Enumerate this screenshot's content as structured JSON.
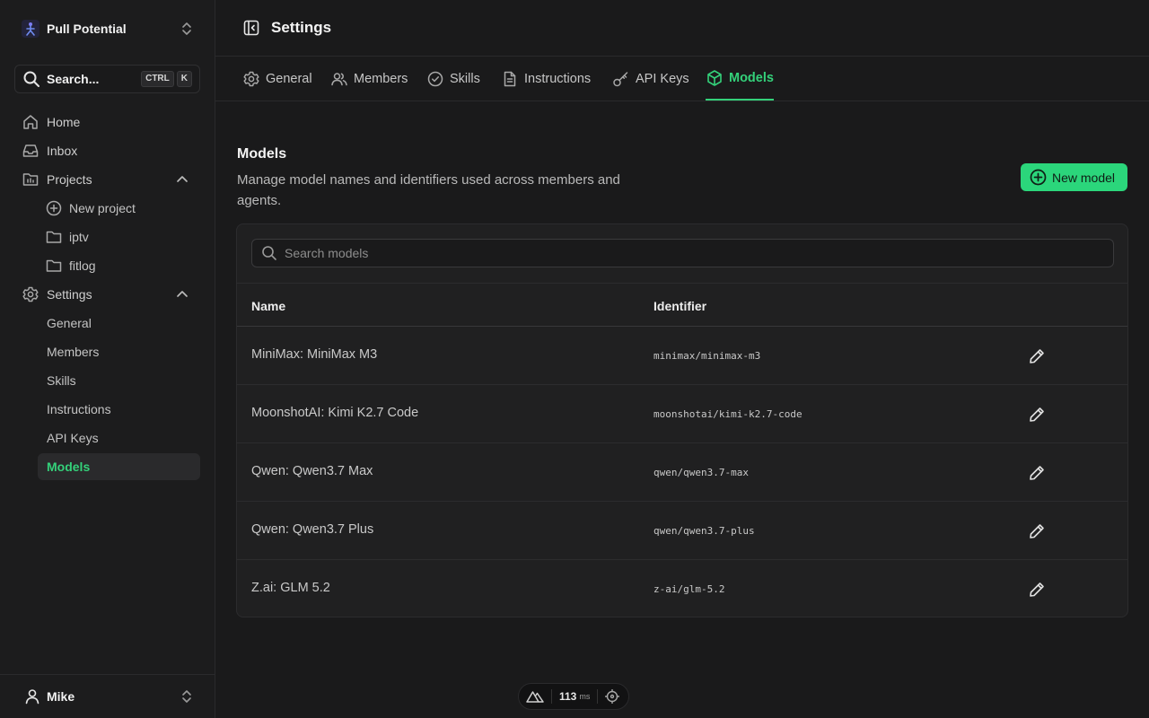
{
  "workspace": {
    "name": "Pull Potential"
  },
  "search": {
    "label": "Search...",
    "key1": "CTRL",
    "key2": "K"
  },
  "nav": {
    "home": "Home",
    "inbox": "Inbox",
    "projects": "Projects",
    "new_project": "New project",
    "project_items": [
      "iptv",
      "fitlog"
    ],
    "settings": "Settings",
    "settings_items": [
      "General",
      "Members",
      "Skills",
      "Instructions",
      "API Keys",
      "Models"
    ]
  },
  "user": {
    "name": "Mike"
  },
  "header": {
    "title": "Settings"
  },
  "tabs": [
    "General",
    "Members",
    "Skills",
    "Instructions",
    "API Keys",
    "Models"
  ],
  "models_section": {
    "title": "Models",
    "description": "Manage model names and identifiers used across members and agents.",
    "new_button": "New model",
    "search_placeholder": "Search models",
    "columns": {
      "name": "Name",
      "identifier": "Identifier"
    },
    "rows": [
      {
        "name": "MiniMax: MiniMax M3",
        "identifier": "minimax/minimax-m3"
      },
      {
        "name": "MoonshotAI: Kimi K2.7 Code",
        "identifier": "moonshotai/kimi-k2.7-code"
      },
      {
        "name": "Qwen: Qwen3.7 Max",
        "identifier": "qwen/qwen3.7-max"
      },
      {
        "name": "Qwen: Qwen3.7 Plus",
        "identifier": "qwen/qwen3.7-plus"
      },
      {
        "name": "Z.ai: GLM 5.2",
        "identifier": "z-ai/glm-5.2"
      }
    ]
  },
  "dev_tools": {
    "ms_value": "113",
    "ms_unit": "ms"
  },
  "colors": {
    "accent": "#34d17a",
    "button_bg": "#2bd67b",
    "background": "#1a1a1b"
  }
}
